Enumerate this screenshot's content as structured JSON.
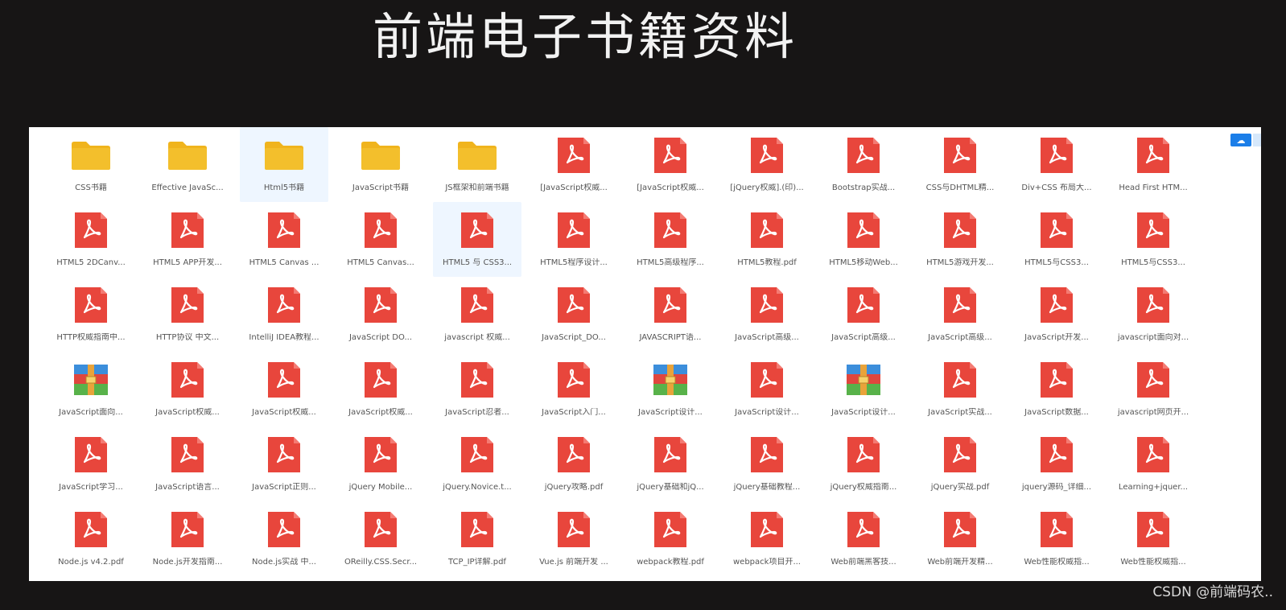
{
  "title": "前端电子书籍资料",
  "watermark": "CSDN @前端码农..",
  "grid": {
    "items": [
      {
        "label": "CSS书籍",
        "type": "folder"
      },
      {
        "label": "Effective JavaSc...",
        "type": "folder"
      },
      {
        "label": "Html5书籍",
        "type": "folder",
        "selected": true
      },
      {
        "label": "JavaScript书籍",
        "type": "folder"
      },
      {
        "label": "JS框架和前端书籍",
        "type": "folder"
      },
      {
        "label": "[JavaScript权威...",
        "type": "pdf"
      },
      {
        "label": "[JavaScript权威...",
        "type": "pdf"
      },
      {
        "label": "[jQuery权威].(印)...",
        "type": "pdf"
      },
      {
        "label": "Bootstrap实战...",
        "type": "pdf"
      },
      {
        "label": "CSS与DHTML精...",
        "type": "pdf"
      },
      {
        "label": "Div+CSS 布局大...",
        "type": "pdf"
      },
      {
        "label": "Head First HTM...",
        "type": "pdf"
      },
      {
        "label": "HTML5 2DCanv...",
        "type": "pdf"
      },
      {
        "label": "HTML5 APP开发...",
        "type": "pdf"
      },
      {
        "label": "HTML5 Canvas ...",
        "type": "pdf"
      },
      {
        "label": "HTML5 Canvas...",
        "type": "pdf"
      },
      {
        "label": "HTML5 与 CSS3...",
        "type": "pdf",
        "selected": true
      },
      {
        "label": "HTML5程序设计...",
        "type": "pdf"
      },
      {
        "label": "HTML5高级程序...",
        "type": "pdf"
      },
      {
        "label": "HTML5教程.pdf",
        "type": "pdf"
      },
      {
        "label": "HTML5移动Web...",
        "type": "pdf"
      },
      {
        "label": "HTML5游戏开发...",
        "type": "pdf"
      },
      {
        "label": "HTML5与CSS3...",
        "type": "pdf"
      },
      {
        "label": "HTML5与CSS3...",
        "type": "pdf"
      },
      {
        "label": "HTTP权威指南中...",
        "type": "pdf"
      },
      {
        "label": "HTTP协议 中文...",
        "type": "pdf"
      },
      {
        "label": "IntelliJ IDEA教程...",
        "type": "pdf"
      },
      {
        "label": "JavaScript DO...",
        "type": "pdf"
      },
      {
        "label": "javascript 权威...",
        "type": "pdf"
      },
      {
        "label": "JavaScript_DO...",
        "type": "pdf"
      },
      {
        "label": "JAVASCRIPT语...",
        "type": "pdf"
      },
      {
        "label": "JavaScript高级...",
        "type": "pdf"
      },
      {
        "label": "JavaScript高级...",
        "type": "pdf"
      },
      {
        "label": "JavaScript高级...",
        "type": "pdf"
      },
      {
        "label": "JavaScript开发...",
        "type": "pdf"
      },
      {
        "label": "javascript面向对...",
        "type": "pdf"
      },
      {
        "label": "JavaScript面向...",
        "type": "rar"
      },
      {
        "label": "JavaScript权威...",
        "type": "pdf"
      },
      {
        "label": "JavaScript权威...",
        "type": "pdf"
      },
      {
        "label": "JavaScript权威...",
        "type": "pdf"
      },
      {
        "label": "JavaScript忍者...",
        "type": "pdf"
      },
      {
        "label": "JavaScript入门...",
        "type": "pdf"
      },
      {
        "label": "JavaScript设计...",
        "type": "rar"
      },
      {
        "label": "JavaScript设计...",
        "type": "pdf"
      },
      {
        "label": "JavaScript设计...",
        "type": "rar"
      },
      {
        "label": "JavaScript实战...",
        "type": "pdf"
      },
      {
        "label": "JavaScript数据...",
        "type": "pdf"
      },
      {
        "label": "javascript网页开...",
        "type": "pdf"
      },
      {
        "label": "JavaScript学习...",
        "type": "pdf"
      },
      {
        "label": "JavaScript语言...",
        "type": "pdf"
      },
      {
        "label": "JavaScript正则...",
        "type": "pdf"
      },
      {
        "label": "jQuery Mobile...",
        "type": "pdf"
      },
      {
        "label": "jQuery.Novice.t...",
        "type": "pdf"
      },
      {
        "label": "jQuery攻略.pdf",
        "type": "pdf"
      },
      {
        "label": "jQuery基础和jQ...",
        "type": "pdf"
      },
      {
        "label": "jQuery基础教程...",
        "type": "pdf"
      },
      {
        "label": "jQuery权威指南...",
        "type": "pdf"
      },
      {
        "label": "jQuery实战.pdf",
        "type": "pdf"
      },
      {
        "label": "jquery源码_详细...",
        "type": "pdf"
      },
      {
        "label": "Learning+jquer...",
        "type": "pdf"
      },
      {
        "label": "Node.js v4.2.pdf",
        "type": "pdf"
      },
      {
        "label": "Node.js开发指南...",
        "type": "pdf"
      },
      {
        "label": "Node.js实战 中...",
        "type": "pdf"
      },
      {
        "label": "OReilly.CSS.Secr...",
        "type": "pdf"
      },
      {
        "label": "TCP_IP详解.pdf",
        "type": "pdf"
      },
      {
        "label": "Vue.js 前端开发 ...",
        "type": "pdf"
      },
      {
        "label": "webpack教程.pdf",
        "type": "pdf"
      },
      {
        "label": "webpack项目开...",
        "type": "pdf"
      },
      {
        "label": "Web前端黑客技...",
        "type": "pdf"
      },
      {
        "label": "Web前端开发精...",
        "type": "pdf"
      },
      {
        "label": "Web性能权威指...",
        "type": "pdf"
      },
      {
        "label": "Web性能权威指...",
        "type": "pdf"
      }
    ]
  },
  "colors": {
    "folder": "#f0b41d",
    "pdf": "#e8463c",
    "background": "#171515",
    "panel": "#ffffff",
    "accent": "#1b7ee8"
  }
}
